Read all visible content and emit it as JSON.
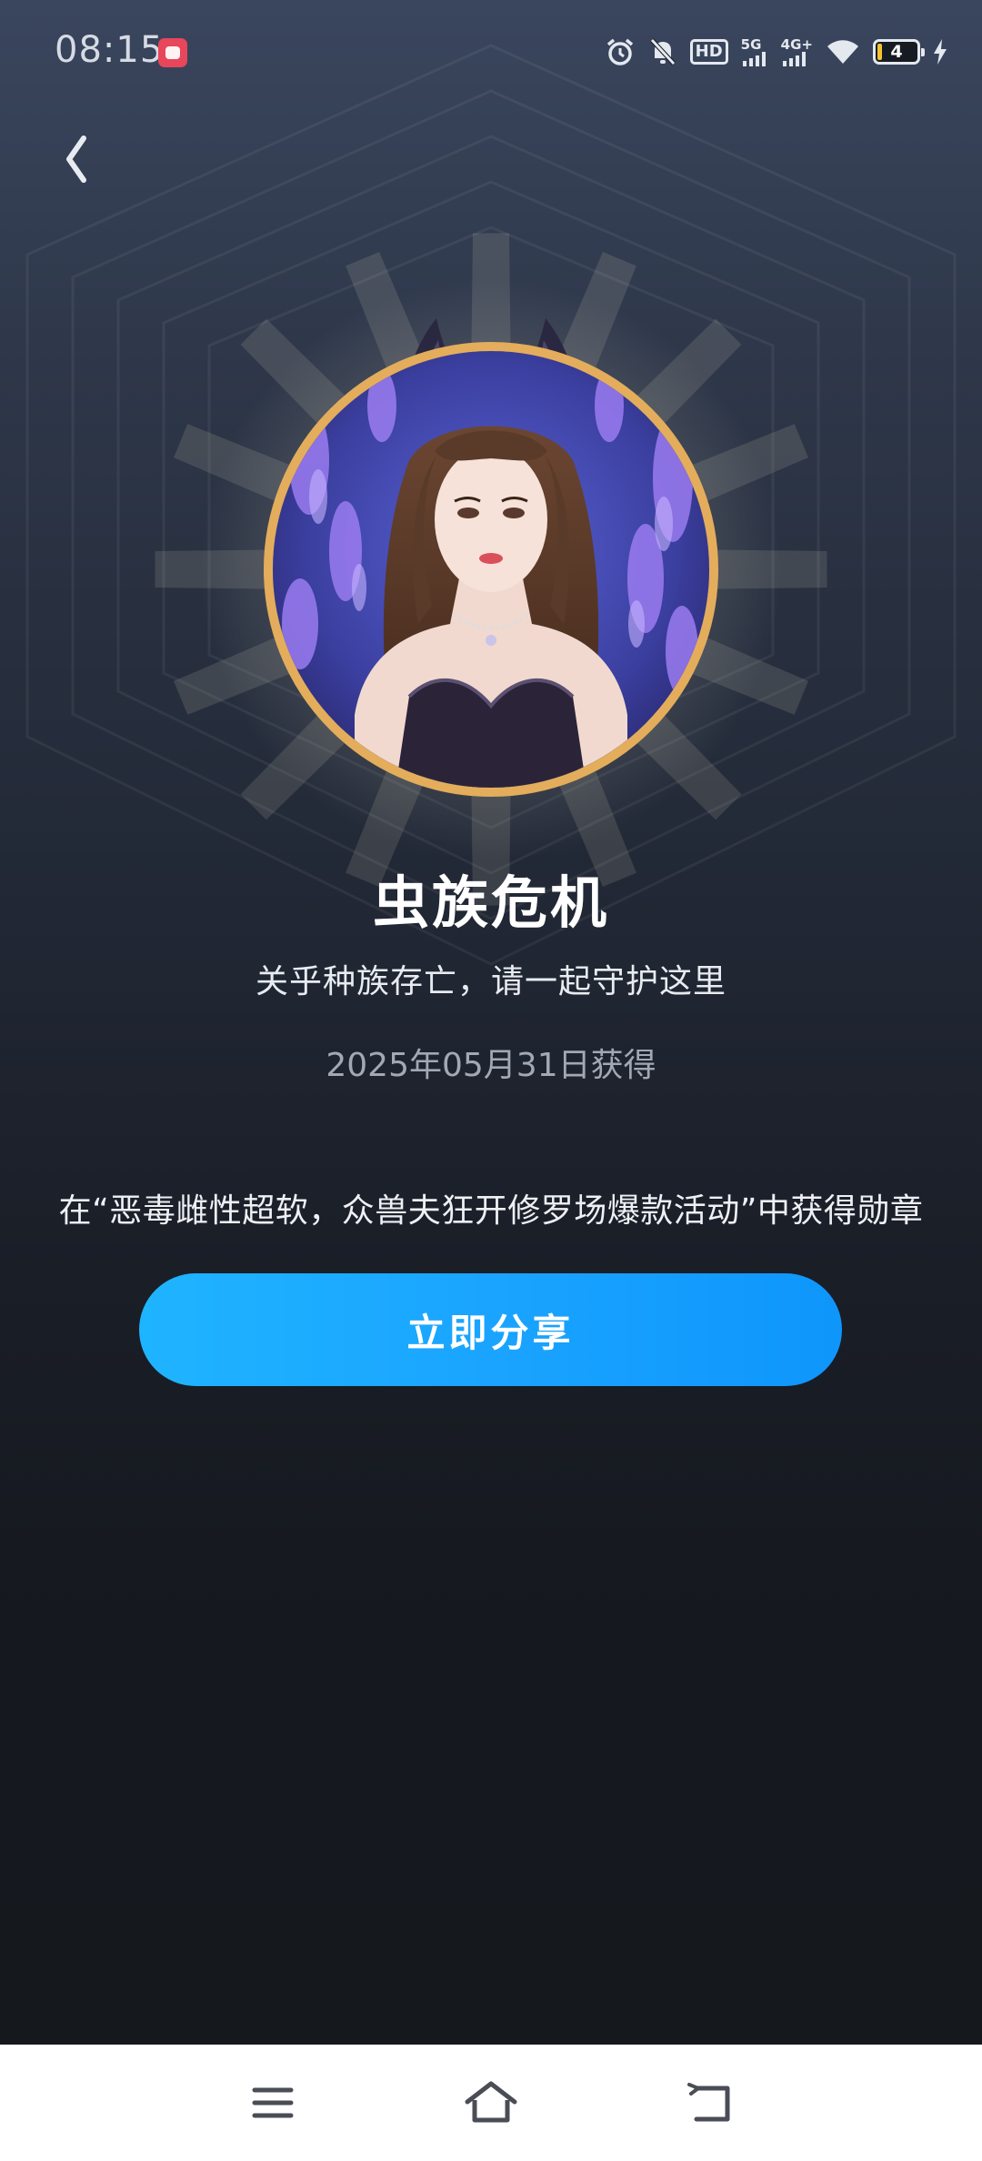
{
  "status_bar": {
    "time": "08:15",
    "hd_label": "HD",
    "net1_label": "5G",
    "net2_label": "4G+",
    "battery_level": "4",
    "icons": [
      "app-notification-icon",
      "alarm-icon",
      "mute-icon",
      "hd-icon",
      "signal-5g-icon",
      "signal-4g-icon",
      "wifi-icon",
      "battery-icon",
      "charging-icon"
    ]
  },
  "header": {
    "back_icon": "chevron-left-icon"
  },
  "medal": {
    "title": "虫族危机",
    "subtitle": "关乎种族存亡，请一起守护这里",
    "obtained_date": "2025年05月31日获得",
    "description": "在“恶毒雌性超软，众兽夫狂开修罗场爆款活动”中获得勋章",
    "image_icon": "character-portrait-badge",
    "frame_color": "#e3ad5c"
  },
  "actions": {
    "share_label": "立即分享",
    "share_color": "#1aa4ff"
  },
  "nav_bar": {
    "items": [
      "menu-icon",
      "home-icon",
      "back-icon"
    ]
  }
}
